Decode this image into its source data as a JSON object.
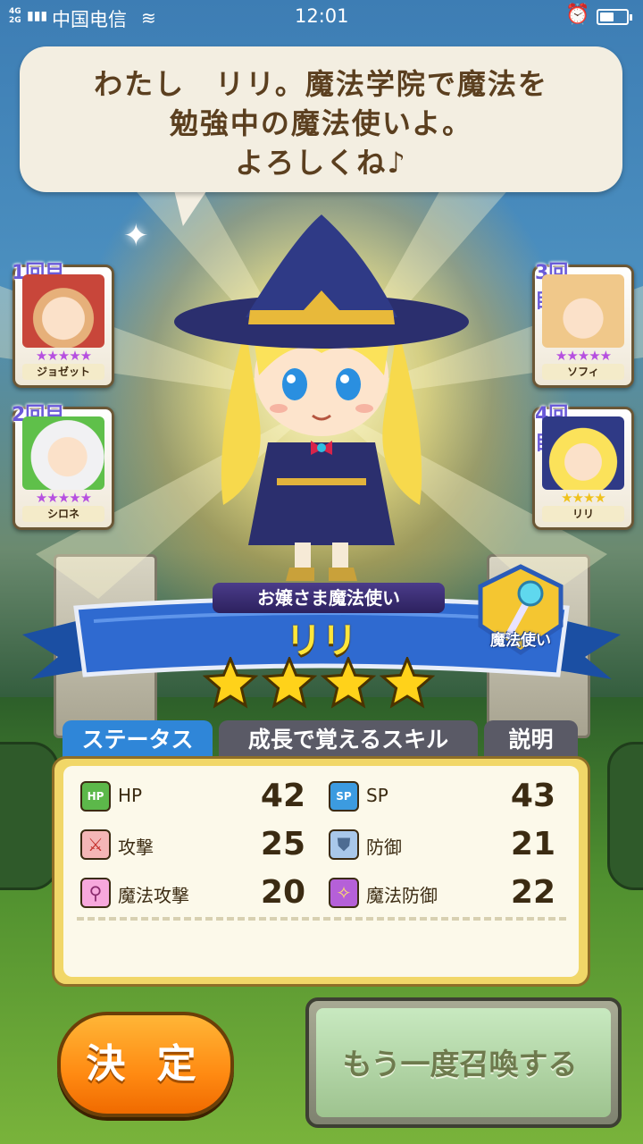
{
  "status_bar": {
    "network": "4G\n2G",
    "carrier": "中国电信",
    "time": "12:01",
    "battery_level": 0.55
  },
  "speech": {
    "line1": "わたし　リリ。魔法学院で魔法を",
    "line2": "勉強中の魔法使いよ。",
    "line3": "よろしくね♪"
  },
  "summons": [
    {
      "round": "1回目",
      "name": "ジョゼット",
      "stars": 5
    },
    {
      "round": "2回目",
      "name": "シロネ",
      "stars": 5
    },
    {
      "round": "3回目",
      "name": "ソフィ",
      "stars": 5
    },
    {
      "round": "4回目",
      "name": "リリ",
      "stars": 4
    }
  ],
  "character": {
    "title": "お嬢さま魔法使い",
    "name": "リリ",
    "rarity": 4,
    "class": "魔法使い"
  },
  "tabs": [
    {
      "label": "ステータス"
    },
    {
      "label": "成長で覚えるスキル"
    },
    {
      "label": "説明"
    }
  ],
  "stats": [
    {
      "label": "HP",
      "value": "42"
    },
    {
      "label": "SP",
      "value": "43"
    },
    {
      "label": "攻撃",
      "value": "25"
    },
    {
      "label": "防御",
      "value": "21"
    },
    {
      "label": "魔法攻撃",
      "value": "20"
    },
    {
      "label": "魔法防御",
      "value": "22"
    }
  ],
  "buttons": {
    "confirm": "決 定",
    "summon_again": "もう一度召喚する"
  },
  "icons": {
    "hp": "hp-icon",
    "sp": "sp-icon",
    "attack": "sword-icon",
    "defense": "shield-icon",
    "magic_attack": "wand-icon",
    "magic_defense": "magic-shield-icon",
    "class": "staff-icon"
  },
  "colors": {
    "active_tab": "#2f86d8",
    "confirm_button": "#ff8a12",
    "star_gold": "#ffd21a",
    "portrait_star": "#b64fe0"
  }
}
